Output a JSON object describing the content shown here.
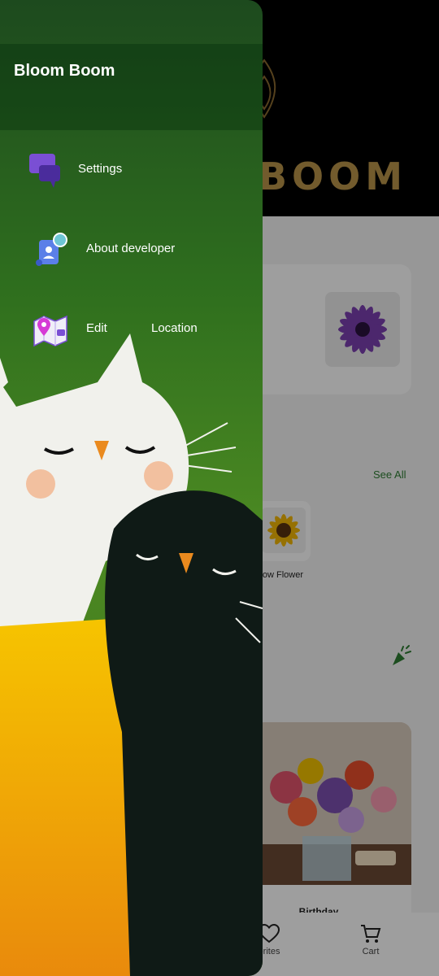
{
  "app": {
    "banner_logo_text": "BOOM",
    "see_all": "See All",
    "category_label": "llow Flower",
    "product_label": "Birthday"
  },
  "bottom_nav": {
    "favorites_label": "orites",
    "cart_label": "Cart"
  },
  "drawer": {
    "title": "Bloom Boom",
    "items": [
      {
        "label": "Settings",
        "icon": "chat-bubbles-icon"
      },
      {
        "label": "About developer",
        "icon": "id-badge-icon"
      },
      {
        "label_a": "Edit",
        "label_b": "Location",
        "icon": "map-pin-icon"
      }
    ]
  },
  "colors": {
    "accent_green": "#2e7d32",
    "banner_gold": "#b8944a",
    "scrim": "rgba(0,0,0,0.38)"
  }
}
